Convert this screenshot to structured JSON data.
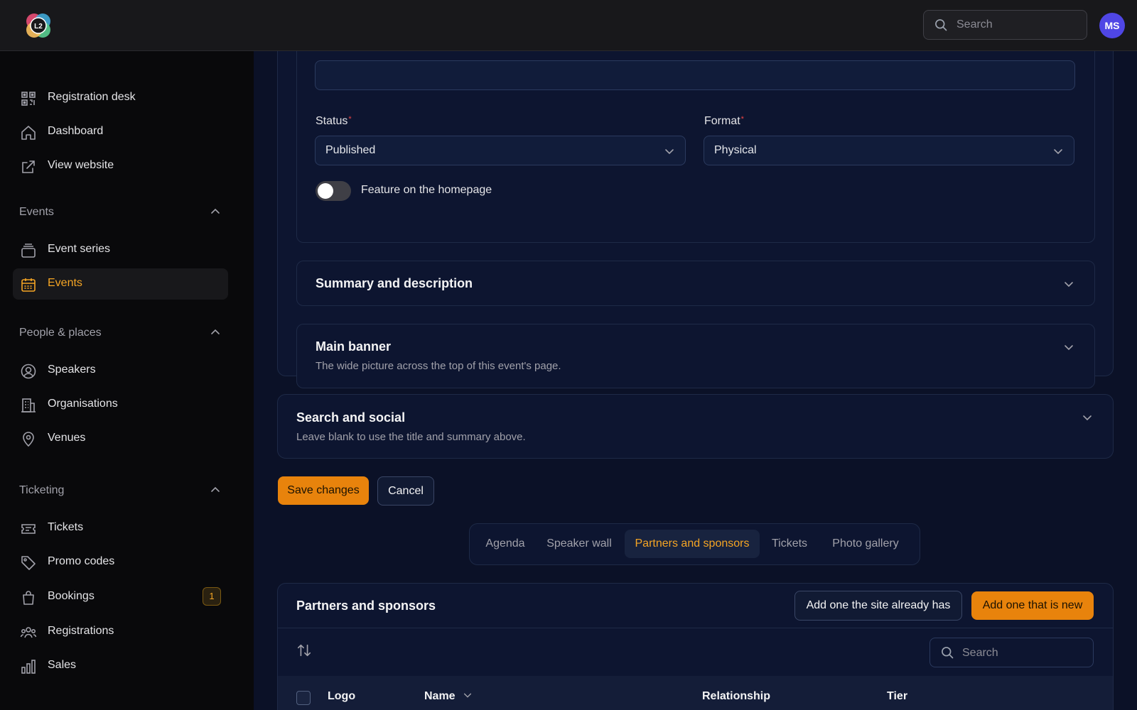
{
  "app": {
    "logo_text": "L2",
    "search_placeholder": "Search",
    "avatar_initials": "MS"
  },
  "sidebar": {
    "top_items": [
      {
        "label": "Registration desk",
        "icon": "qr-code-icon"
      },
      {
        "label": "Dashboard",
        "icon": "home-icon"
      },
      {
        "label": "View website",
        "icon": "external-link-icon"
      }
    ],
    "sections": [
      {
        "label": "Events",
        "items": [
          {
            "label": "Event series",
            "icon": "stack-icon"
          },
          {
            "label": "Events",
            "icon": "calendar-icon",
            "active": true
          }
        ]
      },
      {
        "label": "People & places",
        "items": [
          {
            "label": "Speakers",
            "icon": "user-circle-icon"
          },
          {
            "label": "Organisations",
            "icon": "building-icon"
          },
          {
            "label": "Venues",
            "icon": "map-pin-icon"
          }
        ]
      },
      {
        "label": "Ticketing",
        "items": [
          {
            "label": "Tickets",
            "icon": "ticket-icon"
          },
          {
            "label": "Promo codes",
            "icon": "tag-icon"
          },
          {
            "label": "Bookings",
            "icon": "shopping-bag-icon",
            "badge": "1"
          },
          {
            "label": "Registrations",
            "icon": "users-icon"
          },
          {
            "label": "Sales",
            "icon": "bar-chart-icon"
          }
        ]
      }
    ]
  },
  "form": {
    "status_label": "Status",
    "status_value": "Published",
    "format_label": "Format",
    "format_value": "Physical",
    "feature_toggle_label": "Feature on the homepage",
    "feature_toggle_on": false
  },
  "sections": {
    "summary_title": "Summary and description",
    "banner_title": "Main banner",
    "banner_subtitle": "The wide picture across the top of this event's page.",
    "search_social_title": "Search and social",
    "search_social_subtitle": "Leave blank to use the title and summary above."
  },
  "actions": {
    "save_label": "Save changes",
    "cancel_label": "Cancel"
  },
  "tabs": [
    {
      "label": "Agenda"
    },
    {
      "label": "Speaker wall"
    },
    {
      "label": "Partners and sponsors",
      "active": true
    },
    {
      "label": "Tickets"
    },
    {
      "label": "Photo gallery"
    }
  ],
  "partners": {
    "title": "Partners and sponsors",
    "add_existing_label": "Add one the site already has",
    "add_new_label": "Add one that is new",
    "search_placeholder": "Search",
    "columns": [
      "Logo",
      "Name",
      "Relationship",
      "Tier"
    ]
  },
  "colors": {
    "accent": "#e8830c",
    "accent_text": "#f5a524",
    "avatar_bg": "#4f46e5"
  }
}
